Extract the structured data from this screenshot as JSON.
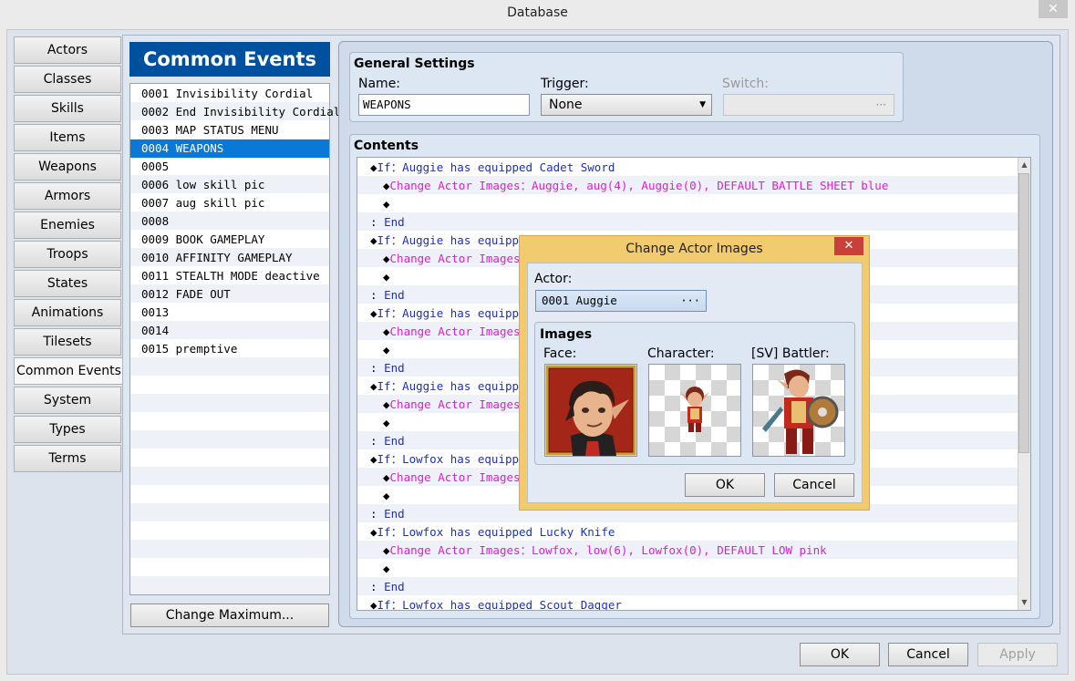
{
  "window": {
    "title": "Database",
    "close_glyph": "✕"
  },
  "tabs": [
    "Actors",
    "Classes",
    "Skills",
    "Items",
    "Weapons",
    "Armors",
    "Enemies",
    "Troops",
    "States",
    "Animations",
    "Tilesets",
    "Common Events",
    "System",
    "Types",
    "Terms"
  ],
  "active_tab": "Common Events",
  "list": {
    "header": "Common Events",
    "items": [
      "0001 Invisibility Cordial",
      "0002 End Invisibility Cordial",
      "0003 MAP STATUS MENU",
      "0004 WEAPONS",
      "0005",
      "0006 low skill pic",
      "0007 aug skill pic",
      "0008",
      "0009 BOOK GAMEPLAY",
      "0010 AFFINITY GAMEPLAY",
      "0011 STEALTH MODE deactive",
      "0012 FADE OUT",
      "0013",
      "0014",
      "0015 premptive"
    ],
    "selected": "0004 WEAPONS",
    "change_max_label": "Change Maximum..."
  },
  "general": {
    "title": "General Settings",
    "name_label": "Name:",
    "name_value": "WEAPONS",
    "trigger_label": "Trigger:",
    "trigger_value": "None",
    "switch_label": "Switch:",
    "switch_button": "···"
  },
  "contents": {
    "title": "Contents",
    "lines": [
      {
        "indent": 0,
        "bullet": "◆",
        "parts": [
          [
            "If：Auggie has equipped Cadet Sword",
            "blue"
          ]
        ]
      },
      {
        "indent": 1,
        "bullet": "◆",
        "parts": [
          [
            "Change Actor Images：Auggie, aug(4), Auggie(0), DEFAULT BATTLE SHEET blue",
            "mag"
          ]
        ]
      },
      {
        "indent": 1,
        "bullet": "◆",
        "parts": []
      },
      {
        "indent": 0,
        "bullet": "",
        "parts": [
          [
            " : ",
            ""
          ],
          [
            "End",
            "blue"
          ]
        ]
      },
      {
        "indent": 0,
        "bullet": "◆",
        "parts": [
          [
            "If：Auggie has equipped",
            "blue"
          ]
        ]
      },
      {
        "indent": 1,
        "bullet": "◆",
        "parts": [
          [
            "Change Actor Images",
            "mag"
          ]
        ]
      },
      {
        "indent": 1,
        "bullet": "◆",
        "parts": []
      },
      {
        "indent": 0,
        "bullet": "",
        "parts": [
          [
            " : ",
            ""
          ],
          [
            "End",
            "blue"
          ]
        ]
      },
      {
        "indent": 0,
        "bullet": "◆",
        "parts": [
          [
            "If：Auggie has equipped",
            "blue"
          ]
        ]
      },
      {
        "indent": 1,
        "bullet": "◆",
        "parts": [
          [
            "Change Actor Images",
            "mag"
          ]
        ]
      },
      {
        "indent": 1,
        "bullet": "◆",
        "parts": []
      },
      {
        "indent": 0,
        "bullet": "",
        "parts": [
          [
            " : ",
            ""
          ],
          [
            "End",
            "blue"
          ]
        ]
      },
      {
        "indent": 0,
        "bullet": "◆",
        "parts": [
          [
            "If：Auggie has equipped",
            "blue"
          ]
        ]
      },
      {
        "indent": 1,
        "bullet": "◆",
        "parts": [
          [
            "Change Actor Images",
            "mag"
          ]
        ]
      },
      {
        "indent": 1,
        "bullet": "◆",
        "parts": []
      },
      {
        "indent": 0,
        "bullet": "",
        "parts": [
          [
            " : ",
            ""
          ],
          [
            "End",
            "blue"
          ]
        ]
      },
      {
        "indent": 0,
        "bullet": "◆",
        "parts": [
          [
            "If：Lowfox has equipped",
            "blue"
          ]
        ]
      },
      {
        "indent": 1,
        "bullet": "◆",
        "parts": [
          [
            "Change Actor Images",
            "mag"
          ]
        ]
      },
      {
        "indent": 1,
        "bullet": "◆",
        "parts": []
      },
      {
        "indent": 0,
        "bullet": "",
        "parts": [
          [
            " : ",
            ""
          ],
          [
            "End",
            "blue"
          ]
        ]
      },
      {
        "indent": 0,
        "bullet": "◆",
        "parts": [
          [
            "If：Lowfox has equipped Lucky Knife",
            "blue"
          ]
        ]
      },
      {
        "indent": 1,
        "bullet": "◆",
        "parts": [
          [
            "Change Actor Images：Lowfox, low(6), Lowfox(0), DEFAULT LOW pink",
            "mag"
          ]
        ]
      },
      {
        "indent": 1,
        "bullet": "◆",
        "parts": []
      },
      {
        "indent": 0,
        "bullet": "",
        "parts": [
          [
            " : ",
            ""
          ],
          [
            "End",
            "blue"
          ]
        ]
      },
      {
        "indent": 0,
        "bullet": "◆",
        "parts": [
          [
            "If：Lowfox has equipped Scout Dagger",
            "blue"
          ]
        ]
      }
    ]
  },
  "dialog": {
    "title": "Change Actor Images",
    "close_glyph": "✕",
    "actor_label": "Actor:",
    "actor_value": "0001 Auggie",
    "actor_button": "···",
    "images_title": "Images",
    "face_label": "Face:",
    "character_label": "Character:",
    "battler_label": "[SV] Battler:",
    "ok": "OK",
    "cancel": "Cancel"
  },
  "footer": {
    "ok": "OK",
    "cancel": "Cancel",
    "apply": "Apply"
  },
  "colors": {
    "selection": "#0a78d7",
    "header_blue": "#0050a0",
    "command_blue": "#1b2fc6",
    "command_magenta": "#e21bd6",
    "dialog_frame": "#f1cb6e"
  }
}
